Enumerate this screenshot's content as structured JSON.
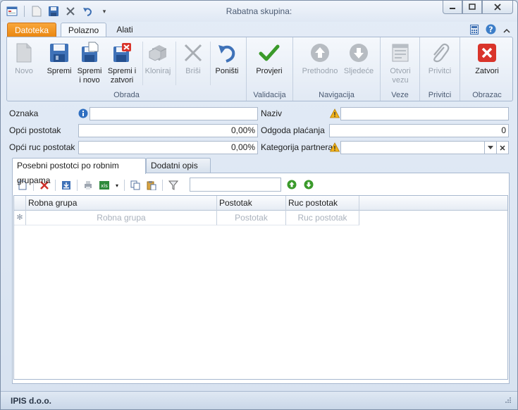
{
  "window": {
    "title": "Rabatna skupina:"
  },
  "ribbon_tabs": {
    "app": "Datoteka",
    "home": "Polazno",
    "tools": "Alati"
  },
  "ribbon": {
    "obrada": {
      "label": "Obrada",
      "buttons": {
        "novo": "Novo",
        "spremi": "Spremi",
        "spremi_novo_1": "Spremi",
        "spremi_novo_2": "i novo",
        "spremi_zatvori_1": "Spremi i",
        "spremi_zatvori_2": "zatvori",
        "kloniraj": "Kloniraj",
        "brisi": "Briši",
        "ponisti": "Poništi"
      }
    },
    "validacija": {
      "label": "Validacija",
      "provjeri": "Provjeri"
    },
    "navigacija": {
      "label": "Navigacija",
      "prethodno": "Prethodno",
      "sljedece": "Sljedeće"
    },
    "veze": {
      "label": "Veze",
      "otvori_1": "Otvori",
      "otvori_2": "vezu"
    },
    "privitci": {
      "label": "Privitci",
      "privitci": "Privitci"
    },
    "obrazac": {
      "label": "Obrazac",
      "zatvori": "Zatvori"
    }
  },
  "form": {
    "oznaka_label": "Oznaka",
    "oznaka_value": "",
    "naziv_label": "Naziv",
    "naziv_value": "",
    "opci_postotak_label": "Opći postotak",
    "opci_postotak_value": "0,00%",
    "odgoda_label": "Odgoda plaćanja",
    "odgoda_value": "0",
    "opci_ruc_label": "Opći ruc postotak",
    "opci_ruc_value": "0,00%",
    "kategorija_label": "Kategorija partnera",
    "kategorija_value": ""
  },
  "page_tabs": {
    "tab1": "Posebni postotci po robnim grupama",
    "tab2": "Dodatni opis"
  },
  "grid": {
    "search_value": "",
    "columns": [
      "Robna grupa",
      "Postotak",
      "Ruc postotak"
    ],
    "new_row_placeholders": [
      "Robna grupa",
      "Postotak",
      "Ruc postotak"
    ]
  },
  "status": {
    "company": "IPIS d.o.o."
  },
  "colors": {
    "accent_orange": "#e9850e",
    "close_red": "#d9342b",
    "check_green": "#3a9a2a"
  }
}
